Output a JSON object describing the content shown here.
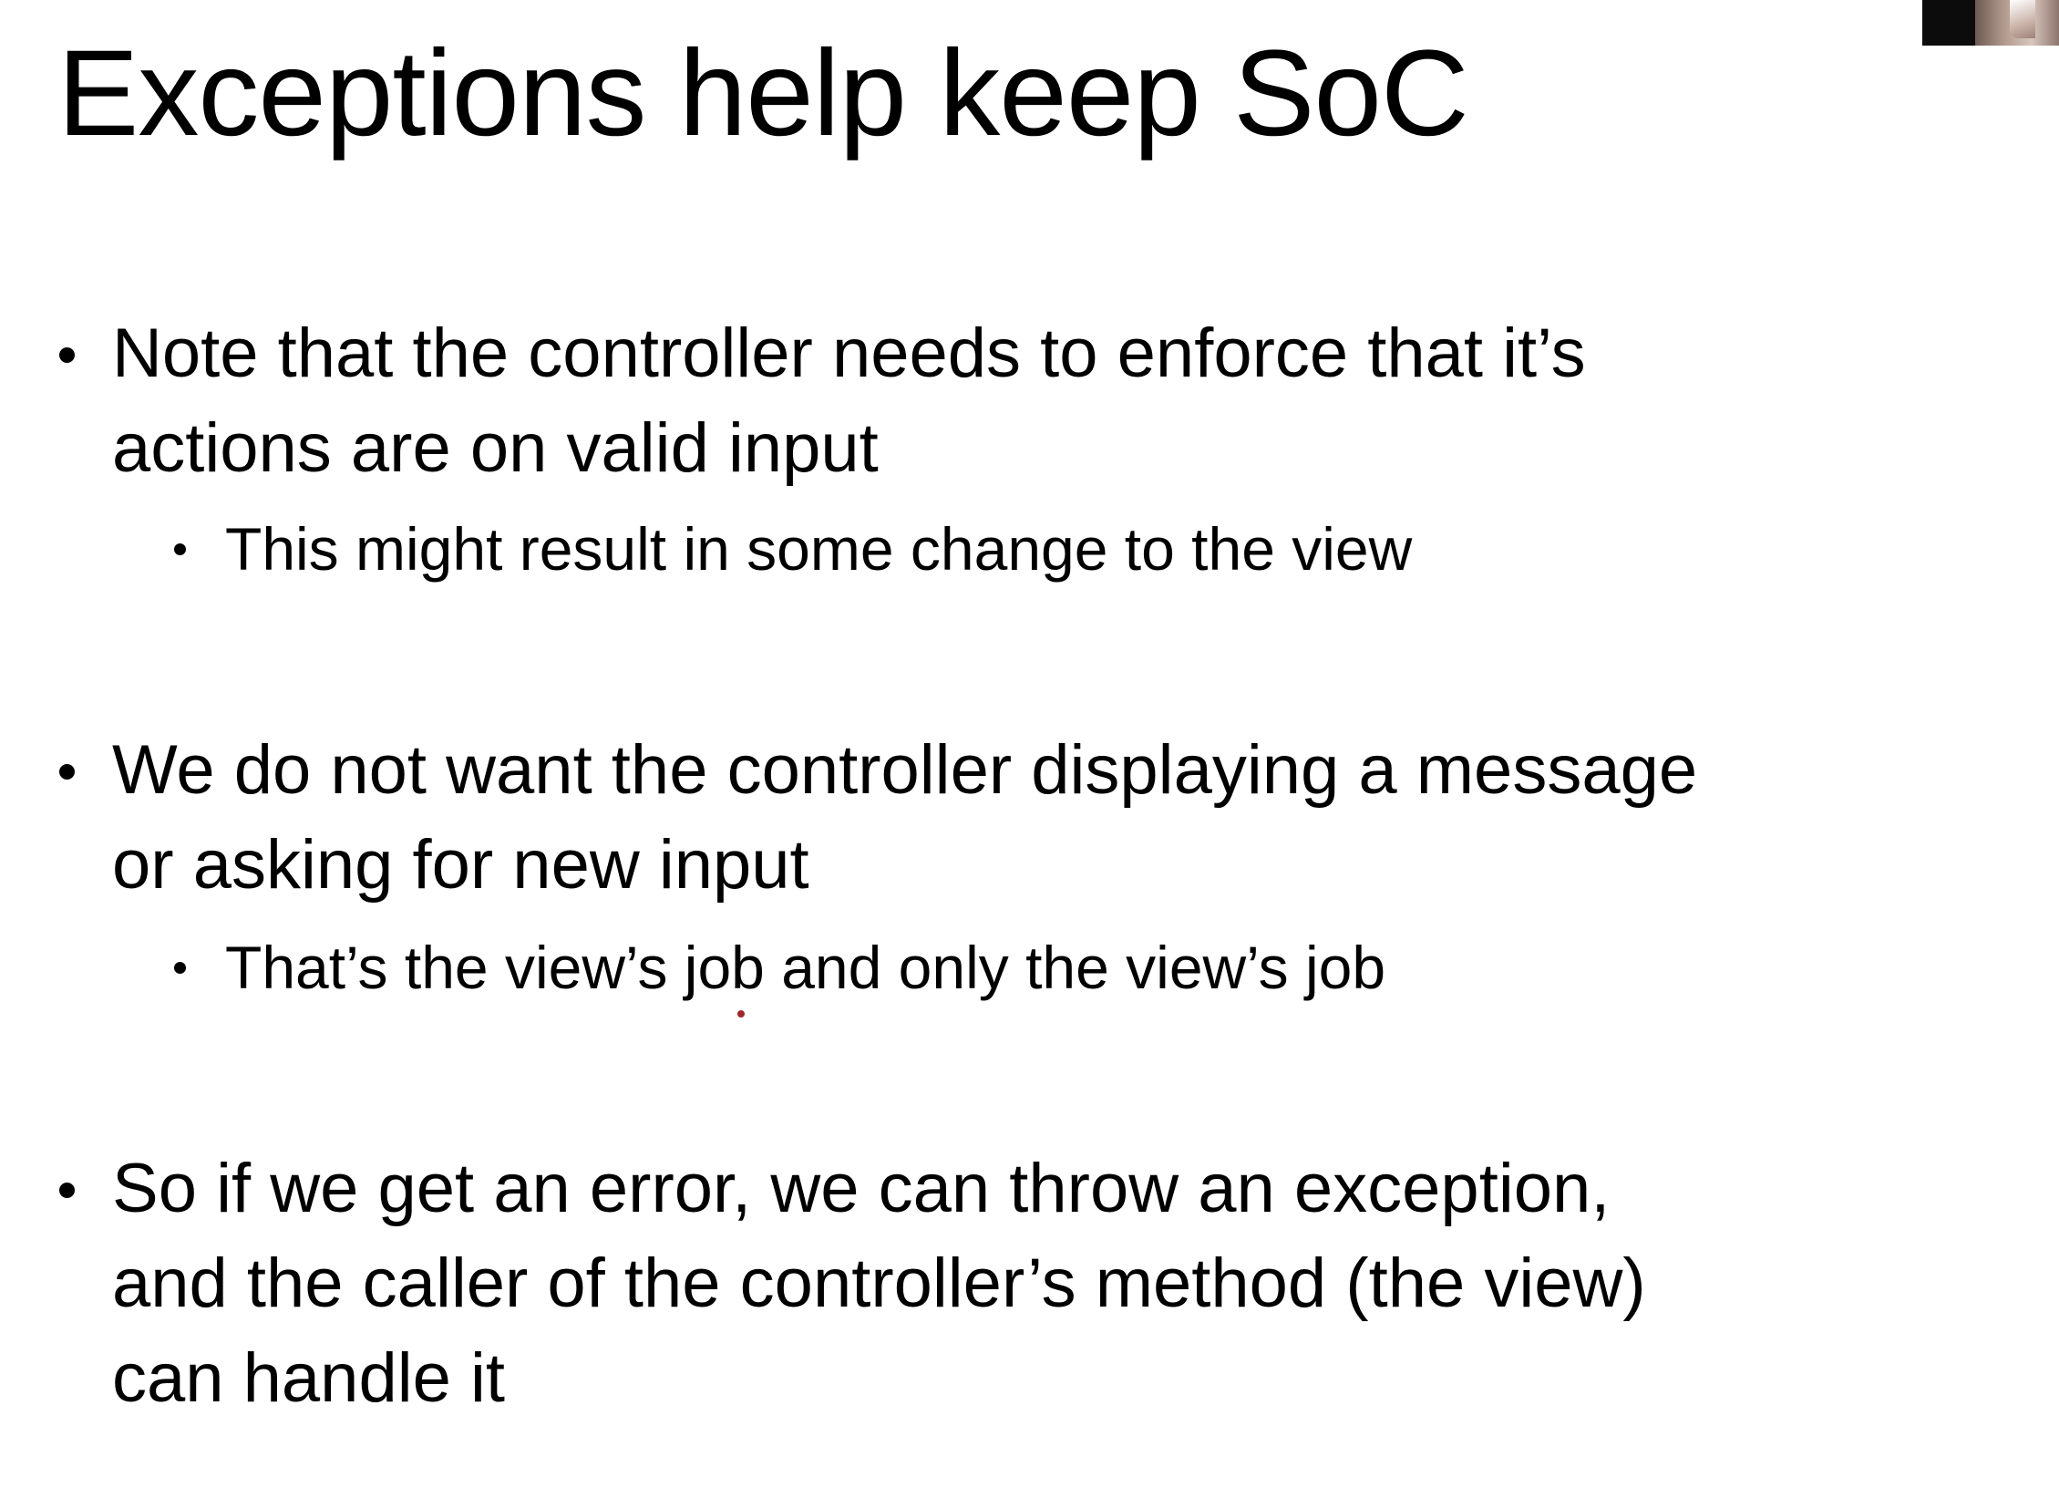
{
  "slide": {
    "title": "Exceptions help keep SoC",
    "bullets": [
      {
        "lines": [
          "Note that the controller needs to enforce that it’s",
          "actions are on valid input"
        ],
        "sub_bullets": [
          "This might result in some change to the view"
        ]
      },
      {
        "lines": [
          "We do not want the controller displaying a message",
          "or asking for new input"
        ],
        "sub_bullets": [
          "That’s the view’s job and only the view’s job"
        ]
      },
      {
        "lines": [
          "So if we get an error, we can throw an exception,",
          "and the caller of the controller’s method (the view)",
          "can handle it"
        ],
        "sub_bullets": []
      }
    ]
  },
  "colors": {
    "background": "#ffffff",
    "text": "#000000",
    "ink_mark": "#a0262e"
  }
}
